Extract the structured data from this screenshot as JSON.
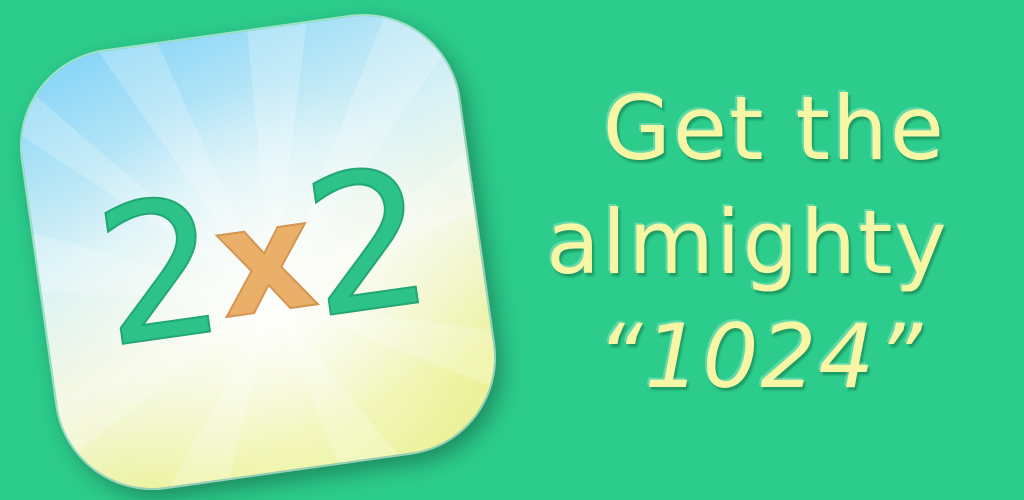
{
  "colors": {
    "background": "#2ccd8c",
    "tagline_text": "#f6f6a4",
    "icon_digits": "#2cc288",
    "icon_multiply": "#eab069",
    "icon_sky_top": "#7fd2f8",
    "icon_sky_bottom": "#ecf29a"
  },
  "app_icon": {
    "icon_name": "2x2-app-icon",
    "operand_left": "2",
    "operator": "x",
    "operand_right": "2"
  },
  "tagline": {
    "line_1": "Get the",
    "line_2": "almighty",
    "line_3": "“1024”"
  }
}
